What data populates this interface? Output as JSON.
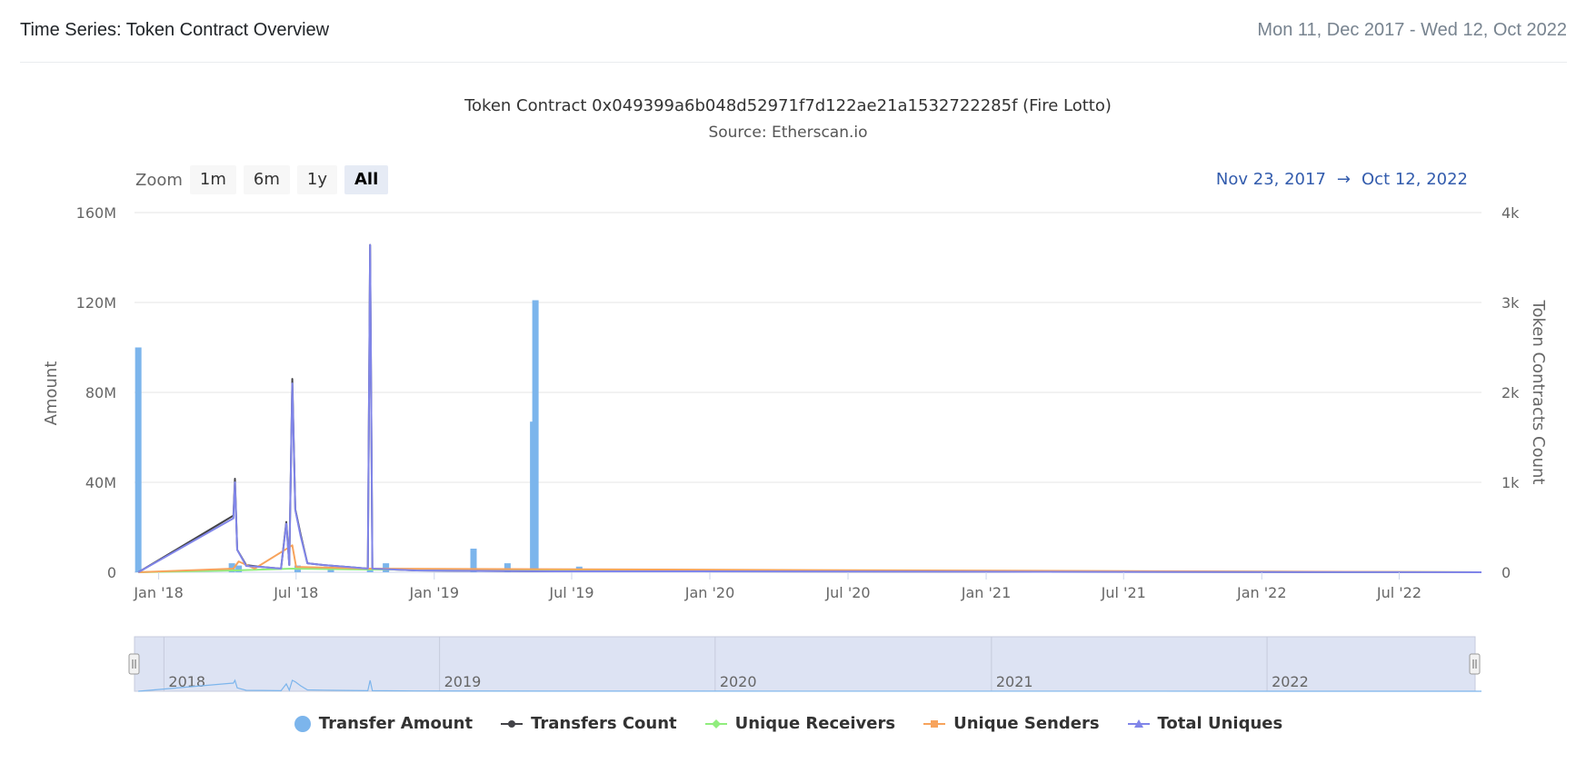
{
  "card": {
    "title": "Time Series: Token Contract Overview",
    "date_range": "Mon 11, Dec 2017 - Wed 12, Oct 2022"
  },
  "toolbar": {
    "zoom_label": "Zoom",
    "buttons": [
      "1m",
      "6m",
      "1y",
      "All"
    ],
    "active": "All",
    "range_from": "Nov 23, 2017",
    "range_arrow": "→",
    "range_to": "Oct 12, 2022"
  },
  "navigator": {
    "years": [
      "2018",
      "2019",
      "2020",
      "2021",
      "2022"
    ]
  },
  "colors": {
    "transfer_amount": "#7cb5ec",
    "transfers_count": "#434348",
    "unique_receivers": "#90ed7d",
    "unique_senders": "#f7a35c",
    "total_uniques": "#8085e9",
    "navigator_mask": "#dde3f3"
  },
  "chart_data": {
    "type": "bar+line",
    "title": "Token Contract 0x049399a6b048d52971f7d122ae21a1532722285f (Fire Lotto)",
    "subtitle": "Source: Etherscan.io",
    "x_range": [
      "2017-11-23",
      "2022-10-12"
    ],
    "x_ticks": [
      {
        "date": "2017-12-25",
        "label": "Jan '18"
      },
      {
        "date": "2018-06-25",
        "label": "Jul '18"
      },
      {
        "date": "2018-12-25",
        "label": "Jan '19"
      },
      {
        "date": "2019-06-25",
        "label": "Jul '19"
      },
      {
        "date": "2019-12-25",
        "label": "Jan '20"
      },
      {
        "date": "2020-06-25",
        "label": "Jul '20"
      },
      {
        "date": "2020-12-25",
        "label": "Jan '21"
      },
      {
        "date": "2021-06-25",
        "label": "Jul '21"
      },
      {
        "date": "2021-12-25",
        "label": "Jan '22"
      },
      {
        "date": "2022-06-25",
        "label": "Jul '22"
      }
    ],
    "y_left": {
      "label": "Amount",
      "ylim": [
        0,
        160000000
      ],
      "ticks": [
        "0",
        "40M",
        "80M",
        "120M",
        "160M"
      ]
    },
    "y_right": {
      "label": "Token Contracts Count",
      "ylim": [
        0,
        4000
      ],
      "ticks": [
        "0",
        "1k",
        "2k",
        "3k",
        "4k"
      ]
    },
    "grid": true,
    "legend_position": "bottom",
    "series": [
      {
        "name": "Transfer Amount",
        "kind": "bar",
        "axis": "left",
        "points": [
          [
            "2017-11-28",
            100000000
          ],
          [
            "2018-04-01",
            4000000
          ],
          [
            "2018-04-10",
            3000000
          ],
          [
            "2018-06-27",
            3000000
          ],
          [
            "2018-08-10",
            1500000
          ],
          [
            "2018-10-01",
            1500000
          ],
          [
            "2018-10-22",
            4000000
          ],
          [
            "2019-02-15",
            10500000
          ],
          [
            "2019-04-01",
            4000000
          ],
          [
            "2019-05-05",
            67000000
          ],
          [
            "2019-05-08",
            121000000
          ],
          [
            "2019-07-05",
            2500000
          ],
          [
            "2019-08-15",
            1200000
          ]
        ]
      },
      {
        "name": "Transfers Count",
        "kind": "line",
        "axis": "right",
        "points": [
          [
            "2017-11-28",
            0
          ],
          [
            "2018-04-03",
            630
          ],
          [
            "2018-04-05",
            1040
          ],
          [
            "2018-04-08",
            250
          ],
          [
            "2018-04-20",
            80
          ],
          [
            "2018-05-10",
            60
          ],
          [
            "2018-06-05",
            40
          ],
          [
            "2018-06-12",
            560
          ],
          [
            "2018-06-16",
            80
          ],
          [
            "2018-06-20",
            2150
          ],
          [
            "2018-06-24",
            700
          ],
          [
            "2018-07-01",
            420
          ],
          [
            "2018-07-10",
            100
          ],
          [
            "2018-08-01",
            80
          ],
          [
            "2018-09-01",
            60
          ],
          [
            "2018-09-28",
            40
          ],
          [
            "2018-10-01",
            3640
          ],
          [
            "2018-10-04",
            40
          ],
          [
            "2018-12-01",
            20
          ],
          [
            "2019-06-01",
            10
          ],
          [
            "2019-12-01",
            10
          ],
          [
            "2022-10-12",
            0
          ]
        ]
      },
      {
        "name": "Unique Receivers",
        "kind": "line",
        "axis": "right",
        "points": [
          [
            "2017-11-28",
            0
          ],
          [
            "2018-04-03",
            20
          ],
          [
            "2018-06-20",
            40
          ],
          [
            "2018-10-01",
            30
          ],
          [
            "2022-10-12",
            0
          ]
        ]
      },
      {
        "name": "Unique Senders",
        "kind": "line",
        "axis": "right",
        "points": [
          [
            "2017-11-28",
            0
          ],
          [
            "2018-04-03",
            40
          ],
          [
            "2018-04-10",
            120
          ],
          [
            "2018-05-01",
            40
          ],
          [
            "2018-06-20",
            300
          ],
          [
            "2018-06-25",
            60
          ],
          [
            "2018-10-01",
            40
          ],
          [
            "2022-10-12",
            0
          ]
        ]
      },
      {
        "name": "Total Uniques",
        "kind": "line",
        "axis": "right",
        "points": [
          [
            "2017-11-28",
            0
          ],
          [
            "2018-04-03",
            600
          ],
          [
            "2018-04-05",
            1000
          ],
          [
            "2018-04-08",
            250
          ],
          [
            "2018-04-20",
            70
          ],
          [
            "2018-05-10",
            60
          ],
          [
            "2018-06-05",
            40
          ],
          [
            "2018-06-12",
            540
          ],
          [
            "2018-06-16",
            80
          ],
          [
            "2018-06-20",
            2100
          ],
          [
            "2018-06-24",
            690
          ],
          [
            "2018-07-01",
            400
          ],
          [
            "2018-07-10",
            100
          ],
          [
            "2018-08-01",
            80
          ],
          [
            "2018-09-01",
            60
          ],
          [
            "2018-09-28",
            40
          ],
          [
            "2018-10-01",
            3640
          ],
          [
            "2018-10-04",
            40
          ],
          [
            "2018-12-01",
            20
          ],
          [
            "2019-06-01",
            10
          ],
          [
            "2019-12-01",
            10
          ],
          [
            "2022-10-12",
            0
          ]
        ]
      }
    ]
  }
}
